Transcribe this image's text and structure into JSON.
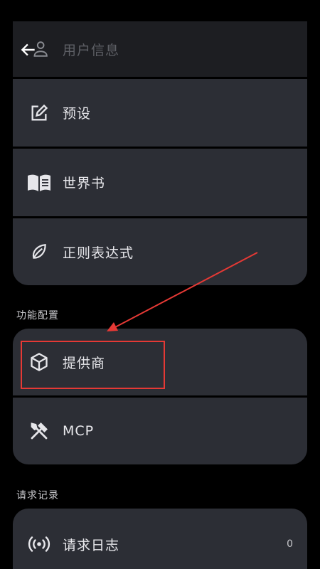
{
  "group1": {
    "items": [
      {
        "label": "用户信息",
        "icon": "user-icon"
      },
      {
        "label": "预设",
        "icon": "edit-icon"
      },
      {
        "label": "世界书",
        "icon": "book-icon"
      },
      {
        "label": "正则表达式",
        "icon": "leaf-icon"
      }
    ]
  },
  "sections": {
    "function_config": "功能配置",
    "request_records": "请求记录"
  },
  "group2": {
    "items": [
      {
        "label": "提供商",
        "icon": "cube-icon"
      },
      {
        "label": "MCP",
        "icon": "tools-icon"
      }
    ]
  },
  "group3": {
    "items": [
      {
        "label": "请求日志",
        "icon": "broadcast-icon",
        "count": "0"
      }
    ]
  },
  "colors": {
    "background": "#000000",
    "card": "#2c2e35",
    "annotation": "#e53935"
  }
}
